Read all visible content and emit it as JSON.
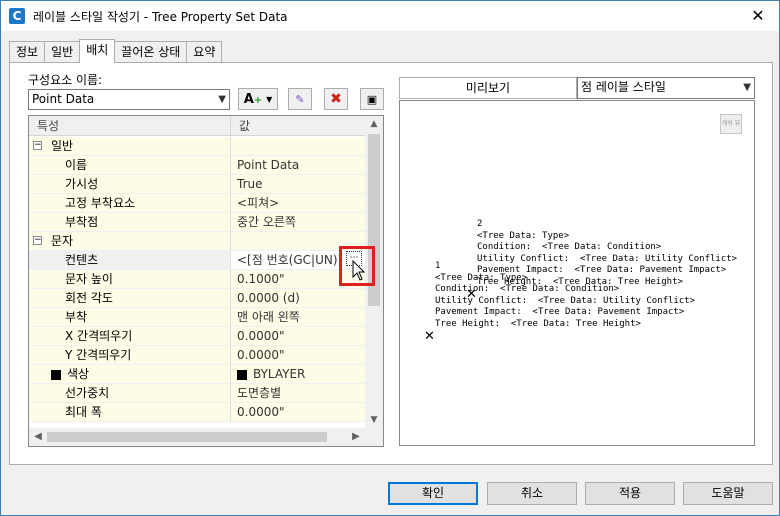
{
  "window": {
    "title": "레이블 스타일 작성기 - Tree Property Set Data"
  },
  "tabs": [
    "정보",
    "일반",
    "배치",
    "끌어온 상태",
    "요약"
  ],
  "component": {
    "label": "구성요소 이름:",
    "value": "Point Data"
  },
  "grid": {
    "header_property": "특성",
    "header_value": "값",
    "rows": [
      {
        "type": "cat",
        "label": "일반",
        "value": ""
      },
      {
        "type": "item",
        "label": "이름",
        "value": "Point Data"
      },
      {
        "type": "item",
        "label": "가시성",
        "value": "True"
      },
      {
        "type": "item",
        "label": "고정 부착요소",
        "value": "<피쳐>"
      },
      {
        "type": "item",
        "label": "부착점",
        "value": "중간 오른쪽"
      },
      {
        "type": "cat",
        "label": "문자",
        "value": ""
      },
      {
        "type": "sel",
        "label": "컨텐츠",
        "value": "<[점 번호(GC|UN)]"
      },
      {
        "type": "item",
        "label": "문자 높이",
        "value": "0.1000\""
      },
      {
        "type": "item",
        "label": "회전 각도",
        "value": "0.0000 (d)"
      },
      {
        "type": "item",
        "label": "부착",
        "value": "맨 아래 왼쪽"
      },
      {
        "type": "item",
        "label": "X 간격띄우기",
        "value": "0.0000\""
      },
      {
        "type": "item",
        "label": "Y 간격띄우기",
        "value": "0.0000\""
      },
      {
        "type": "color",
        "label": "색상",
        "value": "BYLAYER"
      },
      {
        "type": "item",
        "label": "선가중치",
        "value": "도면층별"
      },
      {
        "type": "item",
        "label": "최대 폭",
        "value": "0.0000\""
      }
    ]
  },
  "preview": {
    "tab_label": "미리보기",
    "style_value": "점 레이블 스타일",
    "thumb_label": "캐쉬 뷰",
    "label_a": "2\n<Tree Data: Type>\nCondition:  <Tree Data: Condition>\nUtility Conflict:  <Tree Data: Utility Conflict>\nPavement Impact:  <Tree Data: Pavement Impact>\nTree Height:  <Tree Data: Tree Height>",
    "label_b": "1\n<Tree Data: Type>\nCondition:  <Tree Data: Condition>\nUtility Conflict:  <Tree Data: Utility Conflict>\nPavement Impact:  <Tree Data: Pavement Impact>\nTree Height:  <Tree Data: Tree Height>"
  },
  "buttons": {
    "ok": "확인",
    "cancel": "취소",
    "apply": "적용",
    "help": "도움말"
  }
}
